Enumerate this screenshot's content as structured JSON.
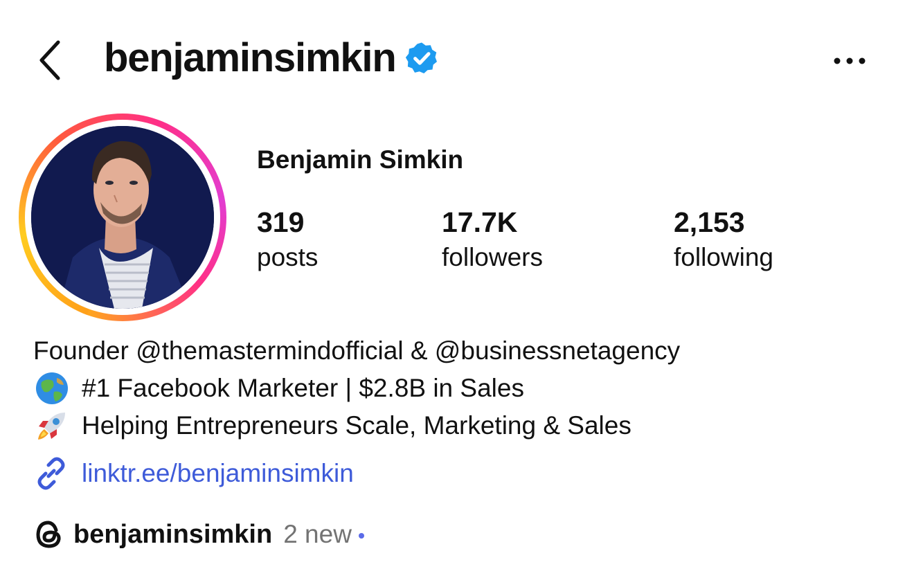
{
  "header": {
    "username": "benjaminsimkin",
    "back_icon": "chevron-left-icon",
    "verified_icon": "verified-badge-icon",
    "more_icon": "more-horizontal-icon"
  },
  "profile": {
    "display_name": "Benjamin Simkin",
    "stats": [
      {
        "value": "319",
        "label": "posts"
      },
      {
        "value": "17.7K",
        "label": "followers"
      },
      {
        "value": "2,153",
        "label": "following"
      }
    ]
  },
  "bio": {
    "line1": "Founder @themastermindofficial & @businessnetagency",
    "line2": "#1 Facebook Marketer | $2.8B in Sales",
    "line2_icon": "globe-emoji-icon",
    "line3": "Helping Entrepreneurs Scale, Marketing & Sales",
    "line3_icon": "rocket-emoji-icon",
    "link": "linktr.ee/benjaminsimkin",
    "link_icon": "link-icon"
  },
  "threads": {
    "username": "benjaminsimkin",
    "new_label": "2 new",
    "icon": "threads-icon"
  },
  "colors": {
    "verified": "#1d9bf0",
    "link": "#3e5bd9",
    "ring_start": "#ff2f87",
    "ring_end": "#ffcc1f"
  }
}
